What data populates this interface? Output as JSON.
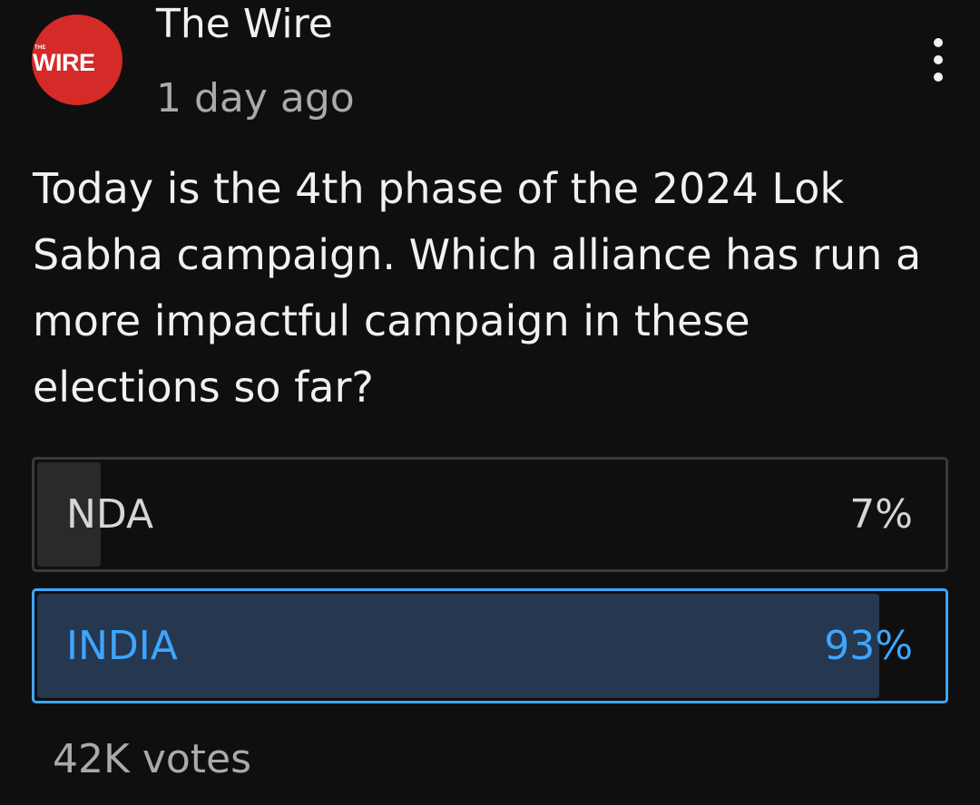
{
  "channel": {
    "logo_small_text": "THE",
    "logo_text": "WIRE",
    "name": "The Wire",
    "posted": "1 day ago",
    "logo_color": "#d42a28"
  },
  "menu_icon": "more-vert-icon",
  "poll": {
    "question": "Today is the 4th phase of the 2024 Lok Sabha campaign. Which alliance has run a more impactful campaign in these elections so far?",
    "options": [
      {
        "label": "NDA",
        "percent_text": "7%",
        "percent": 7,
        "selected": false
      },
      {
        "label": "INDIA",
        "percent_text": "93%",
        "percent": 93,
        "selected": true
      }
    ],
    "votes": "42K votes",
    "accent_color": "#3ea6ff"
  }
}
